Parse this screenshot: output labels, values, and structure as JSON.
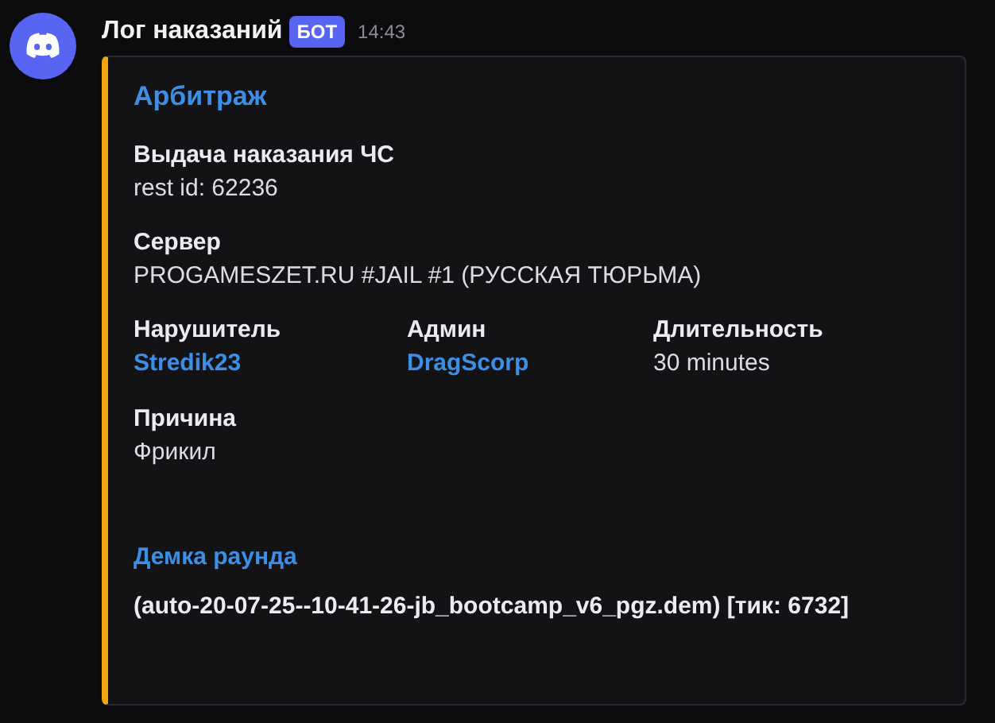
{
  "message": {
    "author": "Лог наказаний",
    "badge": "БОТ",
    "time": "14:43"
  },
  "embed": {
    "color": "#f0a70f",
    "title": "Арбитраж",
    "field_rows": [
      [
        {
          "name": "Выдача наказания ЧС",
          "value": "rest id: 62236",
          "kind": "text"
        }
      ],
      [
        {
          "name": "Сервер",
          "value": "PROGAMESZET.RU #JAIL #1 (РУССКАЯ ТЮРЬМА)",
          "kind": "text"
        }
      ],
      [
        {
          "name": "Нарушитель",
          "value": "Stredik23",
          "kind": "link"
        },
        {
          "name": "Админ",
          "value": "DragScorp",
          "kind": "link"
        },
        {
          "name": "Длительность",
          "value": "30 minutes",
          "kind": "text"
        }
      ],
      [
        {
          "name": "Причина",
          "value": "Фрикил",
          "kind": "text"
        }
      ]
    ],
    "link": "Демка раунда",
    "description": "(auto-20-07-25--10-41-26-jb_bootcamp_v6_pgz.dem) [тик: 6732]"
  }
}
